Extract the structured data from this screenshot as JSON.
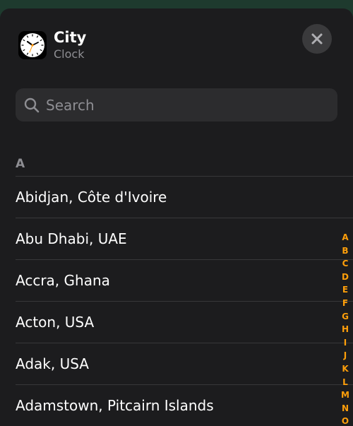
{
  "header": {
    "title": "City",
    "subtitle": "Clock"
  },
  "search": {
    "placeholder": "Search",
    "value": ""
  },
  "section": {
    "letter": "A"
  },
  "cities": [
    "Abidjan, Côte d'Ivoire",
    "Abu Dhabi, UAE",
    "Accra, Ghana",
    "Acton, USA",
    "Adak, USA",
    "Adamstown, Pitcairn Islands"
  ],
  "index_letters": [
    "A",
    "B",
    "C",
    "D",
    "E",
    "F",
    "G",
    "H",
    "I",
    "J",
    "K",
    "L",
    "M",
    "N",
    "O"
  ],
  "icons": {
    "app": "clock-icon",
    "close": "close-icon",
    "search": "search-icon"
  },
  "colors": {
    "background": "#1c1c1e",
    "accent": "#ff9f0a",
    "text": "#ffffff",
    "secondary_text": "#8e8e93",
    "search_field": "#2c2c2e",
    "close_button": "#3a3a3c"
  }
}
